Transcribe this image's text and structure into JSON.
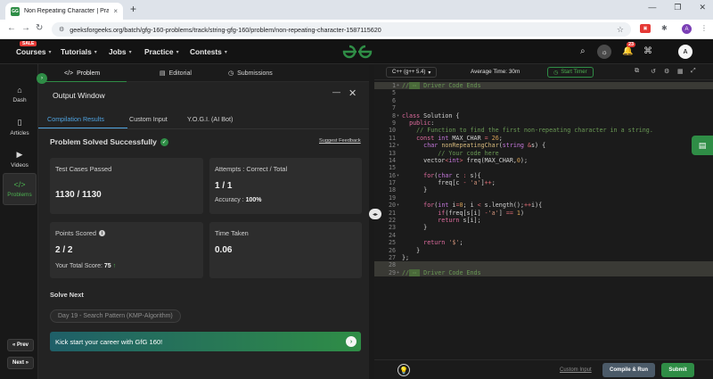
{
  "browser": {
    "tab_title": "Non Repeating Character | Prac",
    "tab_close": "×",
    "new_tab": "+",
    "url": "geeksforgeeks.org/batch/gfg-160-problems/track/string-gfg-160/problem/non-repeating-character-1587115620",
    "profile_initial": "A"
  },
  "header": {
    "sale_badge": "SALE",
    "nav": [
      "Courses",
      "Tutorials",
      "Jobs",
      "Practice",
      "Contests"
    ],
    "notifications_count": "23",
    "user_initial": "A"
  },
  "rail": {
    "items": [
      {
        "label": "Dash",
        "icon": "home-icon"
      },
      {
        "label": "Articles",
        "icon": "book-icon"
      },
      {
        "label": "Videos",
        "icon": "video-icon"
      },
      {
        "label": "Problems",
        "icon": "code-icon"
      }
    ],
    "prev": "« Prev",
    "next": "Next »"
  },
  "left_tabs": [
    "Problem",
    "Editorial",
    "Submissions"
  ],
  "output": {
    "title": "Output Window",
    "tabs": [
      "Compilation Results",
      "Custom Input",
      "Y.O.G.I. (AI Bot)"
    ],
    "status": "Problem Solved Successfully",
    "feedback": "Suggest Feedback",
    "cards": {
      "tests_label": "Test Cases Passed",
      "tests_value": "1130 / 1130",
      "attempts_label": "Attempts : Correct / Total",
      "attempts_value": "1 / 1",
      "accuracy_label": "Accuracy : ",
      "accuracy_value": "100%",
      "points_label": "Points Scored",
      "points_value": "2 / 2",
      "total_label": "Your Total Score: ",
      "total_value": "75",
      "time_label": "Time Taken",
      "time_value": "0.06"
    },
    "solve_next": "Solve Next",
    "next_chip": "Day 19 - Search Pattern (KMP-Algorithm)",
    "banner": "Kick start your career with GfG 160!"
  },
  "editor": {
    "language": "C++ (g++ 5.4)",
    "avg_time": "Average Time: 30m",
    "timer": "Start Timer",
    "custom_input": "Custom Input",
    "compile_run": "Compile & Run",
    "submit": "Submit",
    "lines": [
      {
        "n": "1",
        "fold": "+",
        "hl": true,
        "html": "<span class=\"cm\">//</span><span class=\"mark\">&nbsp;⋯&nbsp;</span><span class=\"cm\"> Driver Code Ends</span>"
      },
      {
        "n": "5",
        "fold": "",
        "hl": false,
        "html": ""
      },
      {
        "n": "6",
        "fold": "",
        "hl": false,
        "html": ""
      },
      {
        "n": "7",
        "fold": "",
        "hl": false,
        "html": ""
      },
      {
        "n": "8",
        "fold": "▾",
        "hl": false,
        "html": "<span class=\"kw\">class</span> Solution {"
      },
      {
        "n": "9",
        "fold": "",
        "hl": false,
        "html": "  <span class=\"kw\">public</span>:"
      },
      {
        "n": "10",
        "fold": "",
        "hl": false,
        "html": "    <span class=\"cm\">// Function to find the first non-repeating character in a string.</span>"
      },
      {
        "n": "11",
        "fold": "",
        "hl": false,
        "html": "    <span class=\"kw\">const</span> <span class=\"ty\">int</span> MAX_CHAR <span class=\"op\">=</span> <span class=\"nm\">26</span>;"
      },
      {
        "n": "12",
        "fold": "▾",
        "hl": false,
        "html": "      <span class=\"ty\">char</span> <span class=\"fn\">nonRepeatingChar</span>(<span class=\"ty\">string</span> <span class=\"op\">&amp;</span>s) {"
      },
      {
        "n": "13",
        "fold": "",
        "hl": false,
        "html": "          <span class=\"cm\">// Your code here</span>"
      },
      {
        "n": "14",
        "fold": "",
        "hl": false,
        "html": "      vector<span class=\"op\">&lt;</span><span class=\"ty\">int</span><span class=\"op\">&gt;</span> freq(MAX_CHAR,<span class=\"nm\">0</span>);"
      },
      {
        "n": "15",
        "fold": "",
        "hl": false,
        "html": ""
      },
      {
        "n": "16",
        "fold": "▾",
        "hl": false,
        "html": "      <span class=\"kw\">for</span>(<span class=\"ty\">char</span> c <span class=\"op\">:</span> s){"
      },
      {
        "n": "17",
        "fold": "",
        "hl": false,
        "html": "          freq[c <span class=\"op\">-</span> <span class=\"st\">'a'</span>]<span class=\"op\">++</span>;"
      },
      {
        "n": "18",
        "fold": "",
        "hl": false,
        "html": "      }"
      },
      {
        "n": "19",
        "fold": "",
        "hl": false,
        "html": ""
      },
      {
        "n": "20",
        "fold": "▾",
        "hl": false,
        "html": "      <span class=\"kw\">for</span>(<span class=\"ty\">int</span> i<span class=\"op\">=</span><span class=\"nm\">0</span>; i <span class=\"op\">&lt;</span> s.length();<span class=\"op\">++</span>i){"
      },
      {
        "n": "21",
        "fold": "",
        "hl": false,
        "html": "          <span class=\"kw\">if</span>(freq[s[i] <span class=\"op\">-</span><span class=\"st\">'a'</span>] <span class=\"op\">==</span> <span class=\"nm\">1</span>)"
      },
      {
        "n": "22",
        "fold": "",
        "hl": false,
        "html": "          <span class=\"kw\">return</span> s[i];"
      },
      {
        "n": "23",
        "fold": "",
        "hl": false,
        "html": "      }"
      },
      {
        "n": "24",
        "fold": "",
        "hl": false,
        "html": ""
      },
      {
        "n": "25",
        "fold": "",
        "hl": false,
        "html": "      <span class=\"kw\">return</span> <span class=\"st\">'$'</span>;"
      },
      {
        "n": "26",
        "fold": "",
        "hl": false,
        "html": "    }"
      },
      {
        "n": "27",
        "fold": "",
        "hl": false,
        "html": "};"
      },
      {
        "n": "28",
        "fold": "",
        "hl": true,
        "html": ""
      },
      {
        "n": "29",
        "fold": "+",
        "hl": true,
        "html": "<span class=\"cm\">//</span><span class=\"mark\">&nbsp;⋯&nbsp;</span><span class=\"cm\"> Driver Code Ends</span>"
      }
    ]
  },
  "colors": {
    "brand": "#2f8d46",
    "accent": "#4fa3e0",
    "bg": "#1e1e1e"
  }
}
